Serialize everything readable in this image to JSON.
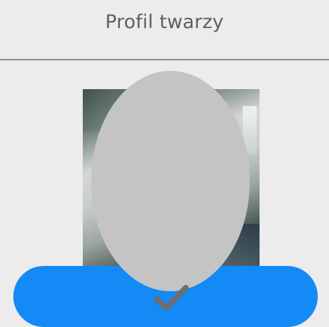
{
  "header": {
    "title": "Profil twarzy"
  },
  "camera": {
    "state": "live preview"
  },
  "face_guide": {
    "shape": "oval",
    "color": "#c4c4c4"
  },
  "confirm": {
    "icon": "checkmark-icon",
    "color": "#138af5",
    "icon_color": "#6e6e6e"
  },
  "colors": {
    "background": "#ececec",
    "title_text": "#5f5f5f",
    "divider": "#8a8a8a"
  }
}
